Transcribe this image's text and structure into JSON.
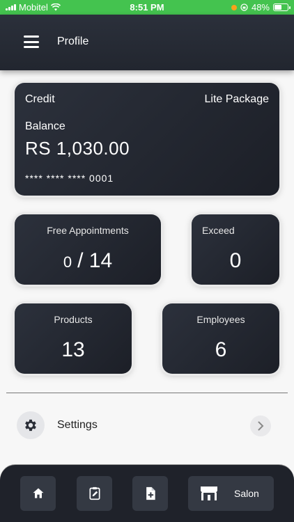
{
  "status_bar": {
    "carrier": "Mobitel",
    "time": "8:51 PM",
    "battery": "48%"
  },
  "header": {
    "title": "Profile",
    "menu_icon": "hamburger-menu-icon"
  },
  "credit_card": {
    "credit_label": "Credit",
    "package": "Lite Package",
    "balance_label": "Balance",
    "amount": "RS 1,030.00",
    "card_number": "**** **** **** 0001"
  },
  "stats": {
    "appointments": {
      "title": "Free Appointments",
      "used": "0",
      "separator": "/",
      "total": "14"
    },
    "exceed": {
      "title": "Exceed",
      "value": "0"
    },
    "products": {
      "title": "Products",
      "value": "13"
    },
    "employees": {
      "title": "Employees",
      "value": "6"
    }
  },
  "settings": {
    "label": "Settings",
    "icon": "gear-icon"
  },
  "bottom_nav": {
    "items": [
      {
        "icon": "home-icon"
      },
      {
        "icon": "clipboard-edit-icon"
      },
      {
        "icon": "document-add-icon"
      },
      {
        "icon": "store-icon",
        "label": "Salon"
      }
    ]
  },
  "colors": {
    "status_bar": "#44c34f",
    "card_bg": "#22262f",
    "nav_bg": "#1f222a"
  }
}
